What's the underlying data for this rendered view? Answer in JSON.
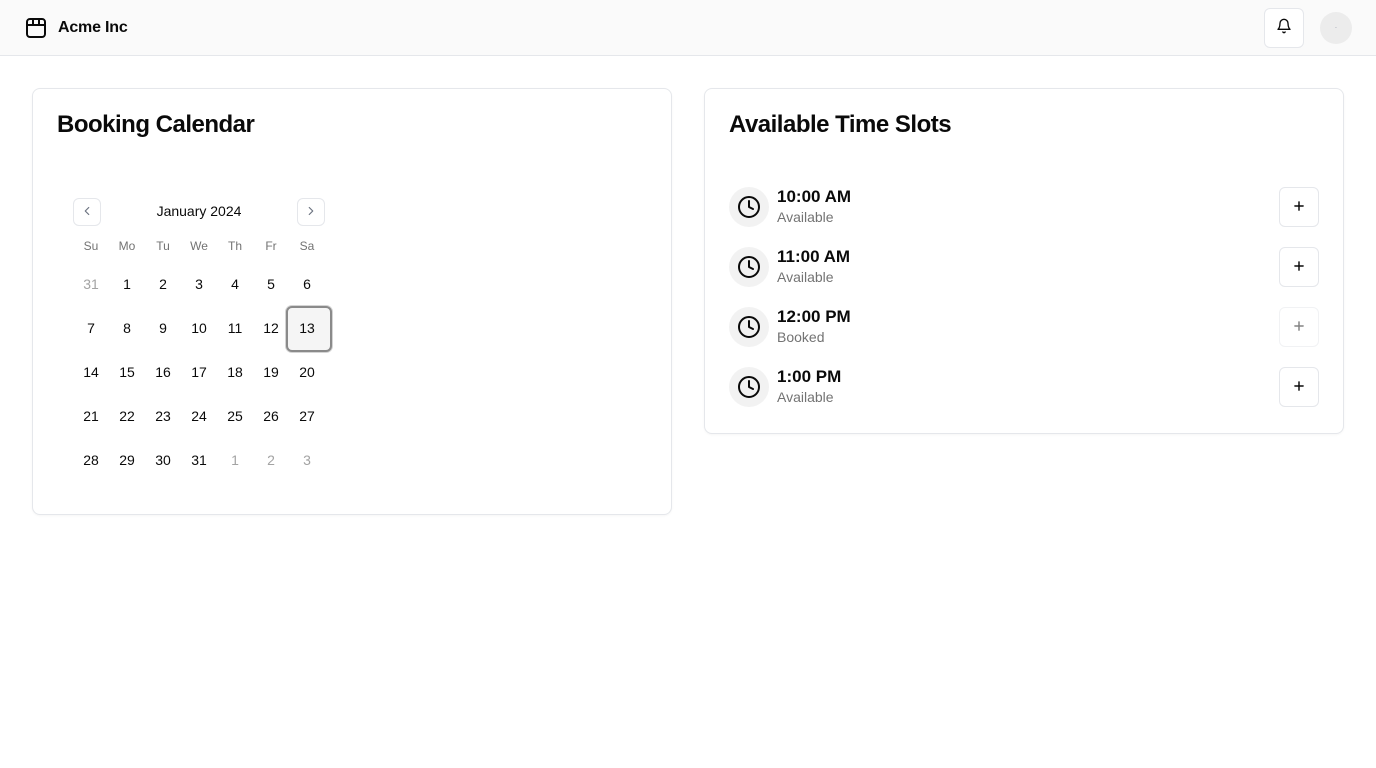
{
  "app": {
    "brand": "Acme Inc",
    "brand_icon": "package-icon",
    "notifications_icon": "bell-icon",
    "avatar_fallback": "·"
  },
  "calendar_card": {
    "title": "Booking Calendar",
    "month_label": "January 2024",
    "weekdays": [
      "Su",
      "Mo",
      "Tu",
      "We",
      "Th",
      "Fr",
      "Sa"
    ],
    "weeks": [
      [
        "31",
        "1",
        "2",
        "3",
        "4",
        "5",
        "6"
      ],
      [
        "7",
        "8",
        "9",
        "10",
        "11",
        "12",
        "13"
      ],
      [
        "14",
        "15",
        "16",
        "17",
        "18",
        "19",
        "20"
      ],
      [
        "21",
        "22",
        "23",
        "24",
        "25",
        "26",
        "27"
      ],
      [
        "28",
        "29",
        "30",
        "31",
        "1",
        "2",
        "3"
      ]
    ],
    "outside_days": [
      [
        0,
        0
      ],
      [
        4,
        4
      ],
      [
        4,
        5
      ],
      [
        4,
        6
      ]
    ],
    "selected_day": "13"
  },
  "slots_card": {
    "title": "Available Time Slots",
    "slots": [
      {
        "time": "10:00 AM",
        "status": "Available",
        "bookable": true
      },
      {
        "time": "11:00 AM",
        "status": "Available",
        "bookable": true
      },
      {
        "time": "12:00 PM",
        "status": "Booked",
        "bookable": false
      },
      {
        "time": "1:00 PM",
        "status": "Available",
        "bookable": true
      }
    ]
  }
}
